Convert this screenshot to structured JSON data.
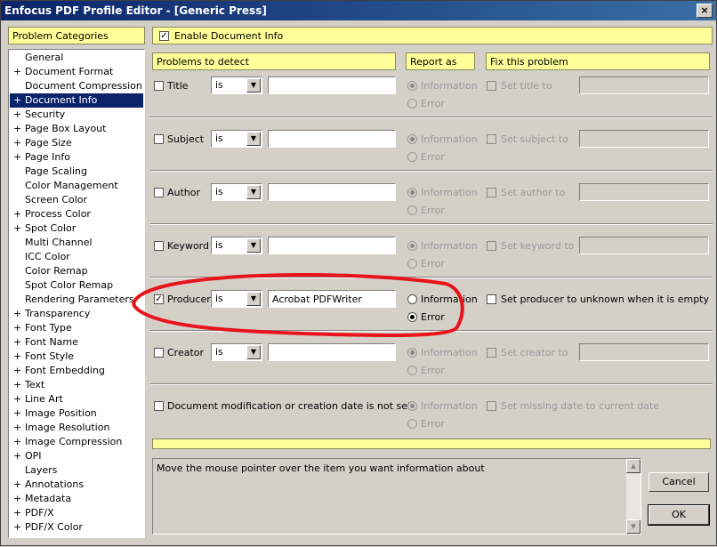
{
  "window": {
    "title": "Enfocus PDF Profile Editor - [Generic Press]",
    "close_glyph": "×"
  },
  "sidebar": {
    "header": "Problem Categories",
    "items": [
      {
        "plus": "",
        "label": "General"
      },
      {
        "plus": "+",
        "label": "Document Format"
      },
      {
        "plus": "",
        "label": "Document Compression"
      },
      {
        "plus": "+",
        "label": "Document Info",
        "selected": true
      },
      {
        "plus": "+",
        "label": "Security"
      },
      {
        "plus": "+",
        "label": "Page Box Layout"
      },
      {
        "plus": "+",
        "label": "Page Size"
      },
      {
        "plus": "+",
        "label": "Page Info"
      },
      {
        "plus": "",
        "label": "Page Scaling"
      },
      {
        "plus": "",
        "label": "Color Management"
      },
      {
        "plus": "",
        "label": "Screen Color"
      },
      {
        "plus": "+",
        "label": "Process Color"
      },
      {
        "plus": "+",
        "label": "Spot Color"
      },
      {
        "plus": "",
        "label": "Multi Channel"
      },
      {
        "plus": "",
        "label": "ICC Color"
      },
      {
        "plus": "",
        "label": "Color Remap"
      },
      {
        "plus": "",
        "label": "Spot Color Remap"
      },
      {
        "plus": "",
        "label": "Rendering Parameters"
      },
      {
        "plus": "+",
        "label": "Transparency"
      },
      {
        "plus": "+",
        "label": "Font Type"
      },
      {
        "plus": "+",
        "label": "Font Name"
      },
      {
        "plus": "+",
        "label": "Font Style"
      },
      {
        "plus": "+",
        "label": "Font Embedding"
      },
      {
        "plus": "+",
        "label": "Text"
      },
      {
        "plus": "+",
        "label": "Line Art"
      },
      {
        "plus": "+",
        "label": "Image Position"
      },
      {
        "plus": "+",
        "label": "Image Resolution"
      },
      {
        "plus": "+",
        "label": "Image Compression"
      },
      {
        "plus": "+",
        "label": "OPI"
      },
      {
        "plus": "",
        "label": "Layers"
      },
      {
        "plus": "+",
        "label": "Annotations"
      },
      {
        "plus": "+",
        "label": "Metadata"
      },
      {
        "plus": "+",
        "label": "PDF/X"
      },
      {
        "plus": "+",
        "label": "PDF/X Color"
      }
    ]
  },
  "enable": {
    "label": "Enable Document Info",
    "checked": true,
    "check_glyph": "✓"
  },
  "columns": {
    "detect": "Problems to detect",
    "report": "Report as",
    "fix": "Fix this problem"
  },
  "rows": [
    {
      "label": "Title",
      "op": "is",
      "value": "",
      "report_info": "Information",
      "report_error": "Error",
      "fix": "Set title to"
    },
    {
      "label": "Subject",
      "op": "is",
      "value": "",
      "report_info": "Information",
      "report_error": "Error",
      "fix": "Set subject to"
    },
    {
      "label": "Author",
      "op": "is",
      "value": "",
      "report_info": "Information",
      "report_error": "Error",
      "fix": "Set author to"
    },
    {
      "label": "Keyword",
      "op": "is",
      "value": "",
      "report_info": "Information",
      "report_error": "Error",
      "fix": "Set keyword to"
    },
    {
      "label": "Producer",
      "op": "is",
      "value": "Acrobat PDFWriter",
      "report_info": "Information",
      "report_error": "Error",
      "fix": "Set producer to unknown when it is empty",
      "checked": true
    },
    {
      "label": "Creator",
      "op": "is",
      "value": "",
      "report_info": "Information",
      "report_error": "Error",
      "fix": "Set creator to"
    }
  ],
  "date_row": {
    "label": "Document modification or creation date is not set",
    "report_info": "Information",
    "report_error": "Error",
    "fix": "Set missing date to current date"
  },
  "dropdown_glyph": "▼",
  "info_text": "Move the mouse pointer over the item you want information about",
  "scroll_up_glyph": "▲",
  "scroll_down_glyph": "▼",
  "buttons": {
    "cancel": "Cancel",
    "ok": "OK"
  },
  "colors": {
    "highlight_stroke": "#e8141b",
    "yellow": "#ffff99",
    "selection": "#0a246a"
  }
}
